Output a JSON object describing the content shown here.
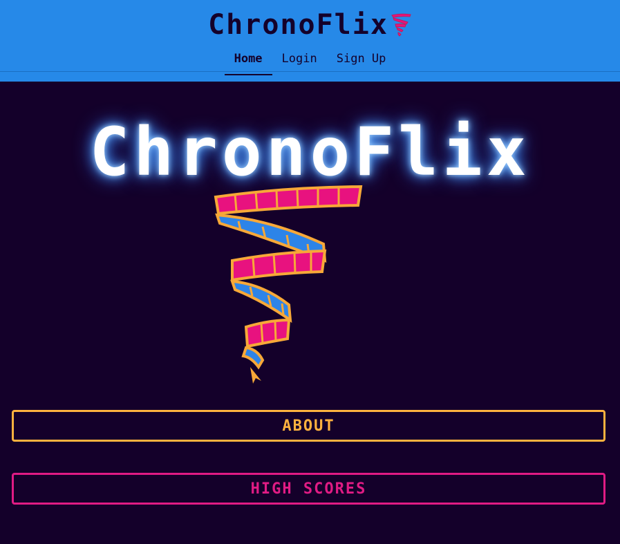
{
  "header": {
    "brand": "ChronoFlix",
    "brand_icon": "film-reel-tornado-icon"
  },
  "nav": {
    "items": [
      {
        "label": "Home",
        "active": true
      },
      {
        "label": "Login",
        "active": false
      },
      {
        "label": "Sign Up",
        "active": false
      }
    ]
  },
  "hero": {
    "title": "ChronoFlix",
    "logo_icon": "film-reel-tornado-icon"
  },
  "buttons": {
    "about": "ABOUT",
    "high_scores": "HIGH SCORES"
  },
  "colors": {
    "header_bg": "#2689e8",
    "page_bg": "#14002a",
    "about_accent": "#ffb23f",
    "scores_accent": "#e01b84",
    "film_pink": "#e8127f",
    "film_blue": "#2d84e8",
    "film_gold": "#f7a838"
  }
}
